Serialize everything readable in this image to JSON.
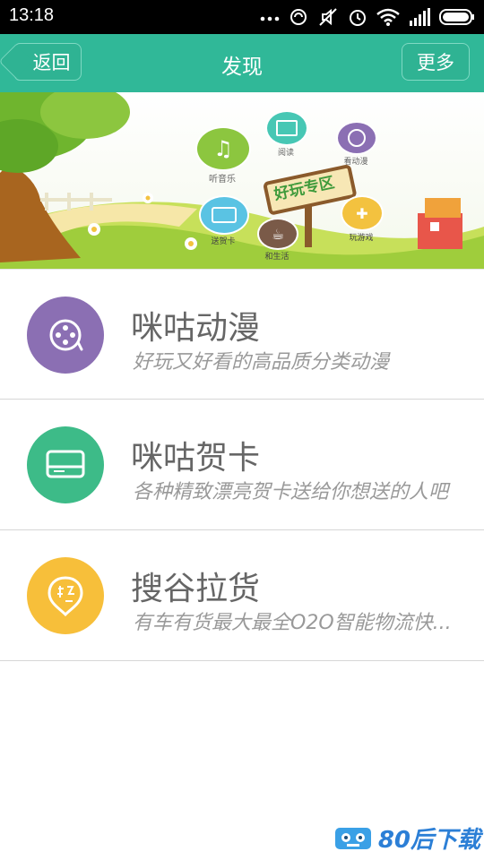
{
  "status_bar": {
    "time": "13:18",
    "icons": [
      "more-icon",
      "sync-icon",
      "mute-icon",
      "alarm-icon",
      "wifi-icon",
      "signal-icon",
      "battery-icon"
    ]
  },
  "header": {
    "back_label": "返回",
    "title": "发现",
    "more_label": "更多"
  },
  "banner": {
    "headline": "好玩专区",
    "bubbles": [
      {
        "label": "听音乐",
        "icon": "music-icon",
        "color": "#8cc63f"
      },
      {
        "label": "阅读",
        "icon": "book-icon",
        "color": "#47c7b4"
      },
      {
        "label": "看动漫",
        "icon": "film-icon",
        "color": "#8b6fb3"
      },
      {
        "label": "送贺卡",
        "icon": "card-icon",
        "color": "#5ac3e3"
      },
      {
        "label": "和生活",
        "icon": "coffee-icon",
        "color": "#7a5a48"
      },
      {
        "label": "玩游戏",
        "icon": "gamepad-icon",
        "color": "#f3c23f"
      }
    ]
  },
  "items": [
    {
      "name": "咪咕动漫",
      "desc": "好玩又好看的高品质分类动漫",
      "icon": "film-reel-icon",
      "color": "#8b6fb3"
    },
    {
      "name": "咪咕贺卡",
      "desc": "各种精致漂亮贺卡送给你想送的人吧",
      "icon": "card-icon",
      "color": "#3dbb88"
    },
    {
      "name": "搜谷拉货",
      "desc": "有车有货最大最全O2O智能物流快...",
      "icon": "cargo-tag-icon",
      "color": "#f7bf3a"
    }
  ],
  "watermark": {
    "text": "80后下载"
  }
}
